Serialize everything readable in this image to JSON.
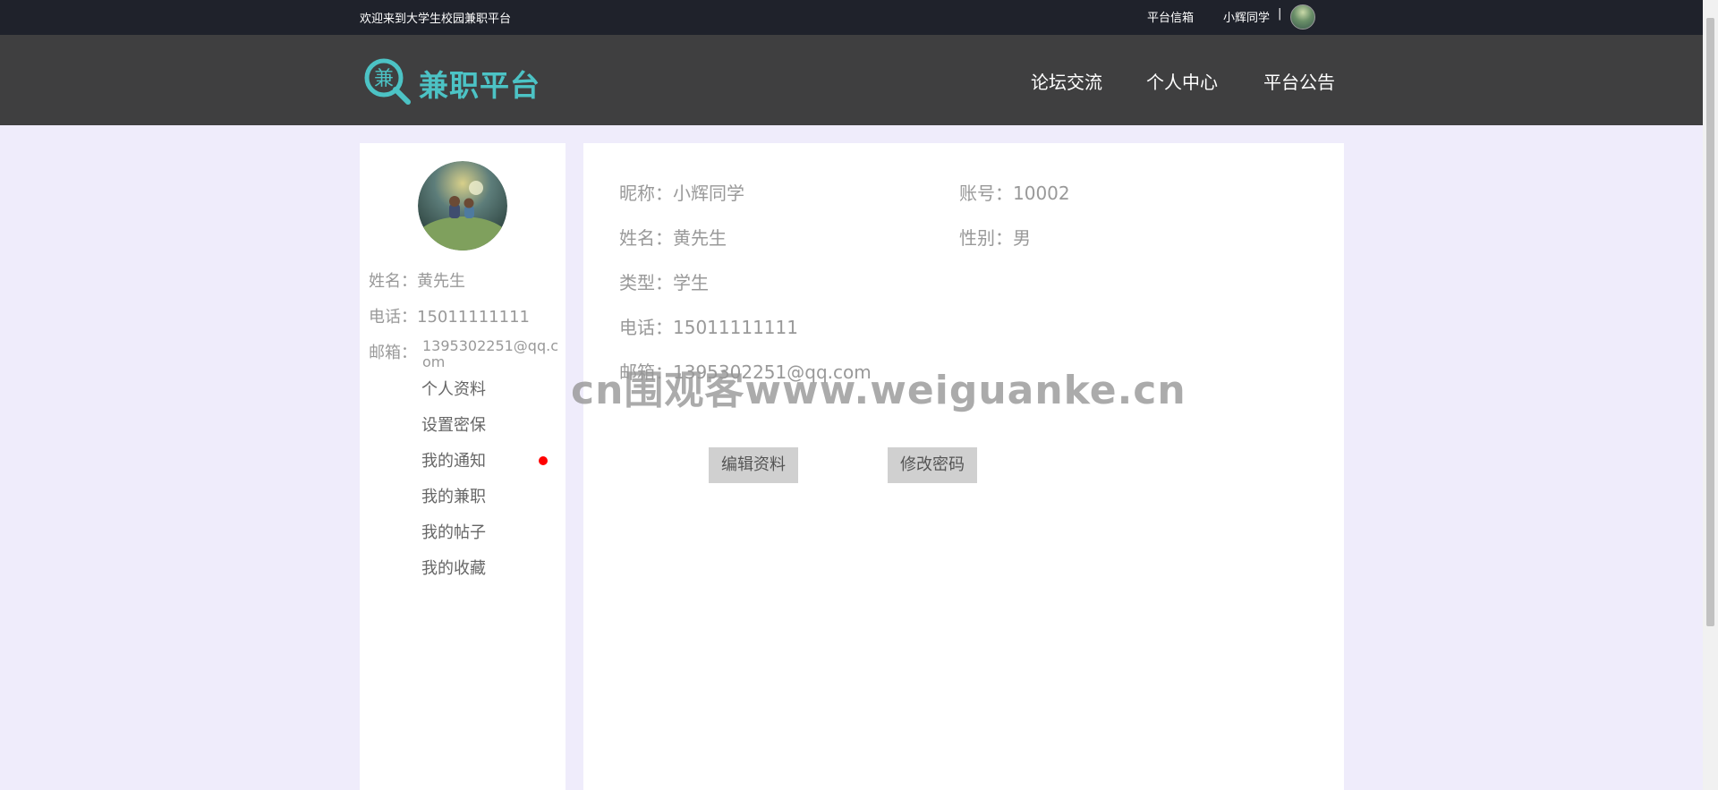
{
  "topbar": {
    "welcome": "欢迎来到大学生校园兼职平台",
    "mailbox": "平台信箱",
    "username": "小辉同学",
    "separator": "|"
  },
  "header": {
    "logo_char": "兼",
    "logo_text": "兼职平台",
    "nav": [
      "论坛交流",
      "个人中心",
      "平台公告"
    ]
  },
  "sidebar": {
    "name_label": "姓名：",
    "name_value": "黄先生",
    "phone_label": "电话：",
    "phone_value": "15011111111",
    "email_label": "邮箱：",
    "email_value": "1395302251@qq.com",
    "menu": [
      "个人资料",
      "设置密保",
      "我的通知",
      "我的兼职",
      "我的帖子",
      "我的收藏"
    ]
  },
  "profile": {
    "nickname_label": "昵称：",
    "nickname_value": "小辉同学",
    "account_label": "账号：",
    "account_value": "10002",
    "name_label": "姓名：",
    "name_value": "黄先生",
    "gender_label": "性别：",
    "gender_value": "男",
    "type_label": "类型：",
    "type_value": "学生",
    "phone_label": "电话：",
    "phone_value": "15011111111",
    "email_label": "邮箱：",
    "email_value": "1395302251@qq.com",
    "edit_button": "编辑资料",
    "password_button": "修改密码"
  },
  "watermark": "cn围观客www.weiguanke.cn",
  "colors": {
    "accent": "#4cc3c5",
    "topbar_bg": "#1f222b",
    "header_bg": "#3f3f40",
    "page_bg": "#efecfb",
    "notify_dot": "#ff0000"
  }
}
